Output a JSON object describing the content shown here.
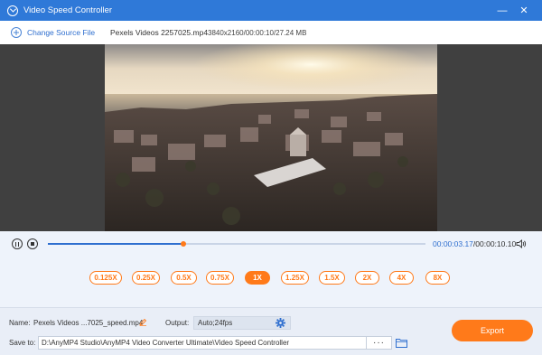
{
  "window": {
    "title": "Video Speed Controller"
  },
  "toolbar": {
    "change_source_label": "Change Source File",
    "file_name": "Pexels Videos 2257025.mp4",
    "file_meta": "3840x2160/00:00:10/27.24 MB"
  },
  "player": {
    "current_time": "00:00:03.17",
    "separator": "/",
    "total_time": "00:00:10.10",
    "progress_fraction": 0.36
  },
  "speeds": {
    "options": [
      "0.125X",
      "0.25X",
      "0.5X",
      "0.75X",
      "1X",
      "1.25X",
      "1.5X",
      "2X",
      "4X",
      "8X"
    ],
    "selected": "1X"
  },
  "bottom": {
    "name_label": "Name:",
    "name_value": "Pexels Videos ...7025_speed.mp4",
    "output_label": "Output:",
    "output_value": "Auto;24fps",
    "save_label": "Save to:",
    "save_path": "D:\\AnyMP4 Studio\\AnyMP4 Video Converter Ultimate\\Video Speed Controller",
    "more_label": "···",
    "export_label": "Export"
  },
  "colors": {
    "titlebar": "#2f79d8",
    "accent": "#ff7a1a",
    "link": "#2f6fcf"
  },
  "icons": [
    "app-icon",
    "minimize-icon",
    "close-icon",
    "add-circle-icon",
    "pause-icon",
    "stop-icon",
    "volume-icon",
    "edit-icon",
    "gear-icon",
    "folder-icon"
  ]
}
